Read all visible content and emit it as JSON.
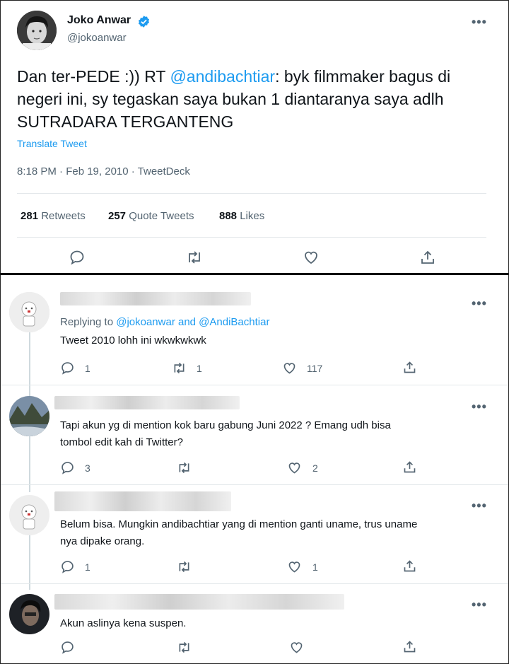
{
  "main_tweet": {
    "author_name": "Joko Anwar",
    "author_handle": "@jokoanwar",
    "text_prefix": "Dan ter-PEDE :)) RT ",
    "mention": "@andibachtiar",
    "text_suffix": ": byk filmmaker bagus di negeri ini, sy tegaskan saya bukan 1 diantaranya saya adlh SUTRADARA TERGANTENG",
    "translate_label": "Translate Tweet",
    "timestamp": "8:18 PM · Feb 19, 2010 · TweetDeck",
    "stats": {
      "retweets_count": "281",
      "retweets_label": "Retweets",
      "quotes_count": "257",
      "quotes_label": "Quote Tweets",
      "likes_count": "888",
      "likes_label": "Likes"
    }
  },
  "replies": [
    {
      "replying_prefix": "Replying to ",
      "replying_to": "@jokoanwar and @AndiBachtiar",
      "text": "Tweet 2010 lohh ini wkwkwkwk",
      "reply_count": "1",
      "retweet_count": "1",
      "like_count": "117"
    },
    {
      "text_line1": "Tapi akun yg di mention kok baru gabung Juni 2022 ? Emang udh bisa",
      "text_line2": "tombol edit kah di Twitter?",
      "reply_count": "3",
      "retweet_count": "",
      "like_count": "2"
    },
    {
      "text_line1": "Belum bisa. Mungkin andibachtiar yang di mention ganti uname, trus uname",
      "text_line2": "nya dipake orang.",
      "reply_count": "1",
      "retweet_count": "",
      "like_count": "1"
    },
    {
      "text": "Akun aslinya kena suspen.",
      "reply_count": "",
      "retweet_count": "",
      "like_count": ""
    }
  ],
  "more_label": "•••",
  "colors": {
    "accent": "#1d9bf0",
    "text": "#0f1419",
    "muted": "#536471",
    "verified": "#1d9bf0"
  },
  "icons": [
    "reply-icon",
    "retweet-icon",
    "like-icon",
    "share-icon",
    "verified-badge-icon",
    "more-icon"
  ]
}
